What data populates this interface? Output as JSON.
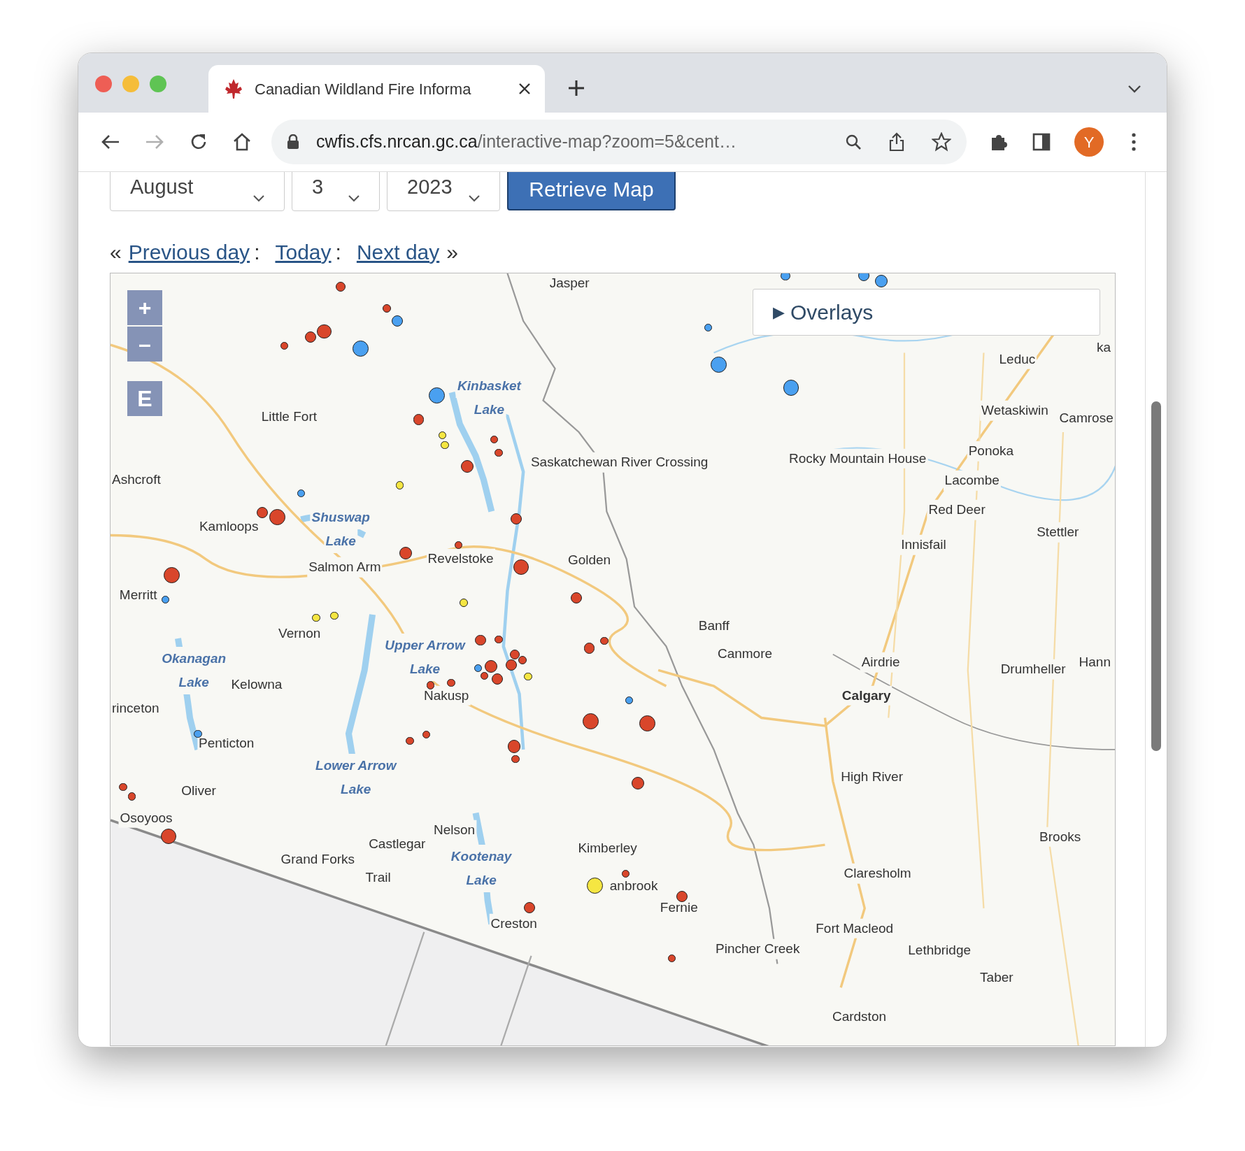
{
  "browser": {
    "tab_title": "Canadian Wildland Fire Informa",
    "url_host": "cwfis.cfs.nrcan.gc.ca",
    "url_path": "/interactive-map?zoom=5&cent…",
    "profile_initial": "Y"
  },
  "date_form": {
    "month": "August",
    "day": "3",
    "year": "2023",
    "button": "Retrieve Map"
  },
  "day_nav": {
    "open": "«",
    "previous": "Previous day",
    "sep1": ":",
    "today": "Today",
    "sep2": ":",
    "next": "Next day",
    "close": "»"
  },
  "map": {
    "zoom_in": "+",
    "zoom_out": "–",
    "extent": "E",
    "overlays": {
      "arrow": "▶",
      "label": "Overlays"
    },
    "labels": [
      {
        "kind": "town",
        "text": "Jasper"
      },
      {
        "kind": "town",
        "text": "ka"
      },
      {
        "kind": "town",
        "text": "Leduc"
      },
      {
        "kind": "lake",
        "lines": [
          "Kinbasket",
          "Lake"
        ]
      },
      {
        "kind": "town",
        "text": "Wetaskiwin"
      },
      {
        "kind": "town",
        "text": "Little Fort"
      },
      {
        "kind": "town",
        "text": "Camrose"
      },
      {
        "kind": "town",
        "text": "Ponoka"
      },
      {
        "kind": "town",
        "text": "Saskatchewan River Crossing"
      },
      {
        "kind": "town",
        "text": "Rocky Mountain House"
      },
      {
        "kind": "town",
        "text": "Ashcroft"
      },
      {
        "kind": "town",
        "text": "Lacombe"
      },
      {
        "kind": "town",
        "text": "Red Deer"
      },
      {
        "kind": "town",
        "text": "Kamloops"
      },
      {
        "kind": "lake",
        "lines": [
          "Shuswap",
          "Lake"
        ]
      },
      {
        "kind": "town",
        "text": "Stettler"
      },
      {
        "kind": "town",
        "text": "Innisfail"
      },
      {
        "kind": "town",
        "text": "Revelstoke"
      },
      {
        "kind": "town",
        "text": "Golden"
      },
      {
        "kind": "town",
        "text": "Salmon Arm"
      },
      {
        "kind": "town",
        "text": "Merritt"
      },
      {
        "kind": "town",
        "text": "Banff"
      },
      {
        "kind": "town",
        "text": "Vernon"
      },
      {
        "kind": "lake",
        "lines": [
          "Okanagan",
          "Lake"
        ]
      },
      {
        "kind": "lake",
        "lines": [
          "Upper Arrow",
          "Lake"
        ]
      },
      {
        "kind": "town",
        "text": "Canmore"
      },
      {
        "kind": "town",
        "text": "Airdrie"
      },
      {
        "kind": "town",
        "text": "Drumheller"
      },
      {
        "kind": "town",
        "text": "Hann"
      },
      {
        "kind": "town",
        "text": "Kelowna"
      },
      {
        "kind": "town",
        "text": "Nakusp"
      },
      {
        "kind": "city",
        "text": "Calgary"
      },
      {
        "kind": "town",
        "text": "rinceton"
      },
      {
        "kind": "town",
        "text": "Penticton"
      },
      {
        "kind": "town",
        "text": "Oliver"
      },
      {
        "kind": "lake",
        "lines": [
          "Lower Arrow",
          "Lake"
        ]
      },
      {
        "kind": "town",
        "text": "High River"
      },
      {
        "kind": "town",
        "text": "Osoyoos"
      },
      {
        "kind": "town",
        "text": "Castlegar"
      },
      {
        "kind": "town",
        "text": "Nelson"
      },
      {
        "kind": "town",
        "text": "Brooks"
      },
      {
        "kind": "town",
        "text": "Grand Forks"
      },
      {
        "kind": "lake",
        "lines": [
          "Kootenay",
          "Lake"
        ]
      },
      {
        "kind": "town",
        "text": "Kimberley"
      },
      {
        "kind": "town",
        "text": "Trail"
      },
      {
        "kind": "town",
        "text": "anbrook"
      },
      {
        "kind": "town",
        "text": "Claresholm"
      },
      {
        "kind": "town",
        "text": "Fernie"
      },
      {
        "kind": "town",
        "text": "Creston"
      },
      {
        "kind": "town",
        "text": "Fort Macleod"
      },
      {
        "kind": "town",
        "text": "Pincher Creek"
      },
      {
        "kind": "town",
        "text": "Lethbridge"
      },
      {
        "kind": "town",
        "text": "Taber"
      },
      {
        "kind": "town",
        "text": "Cardston"
      }
    ]
  }
}
